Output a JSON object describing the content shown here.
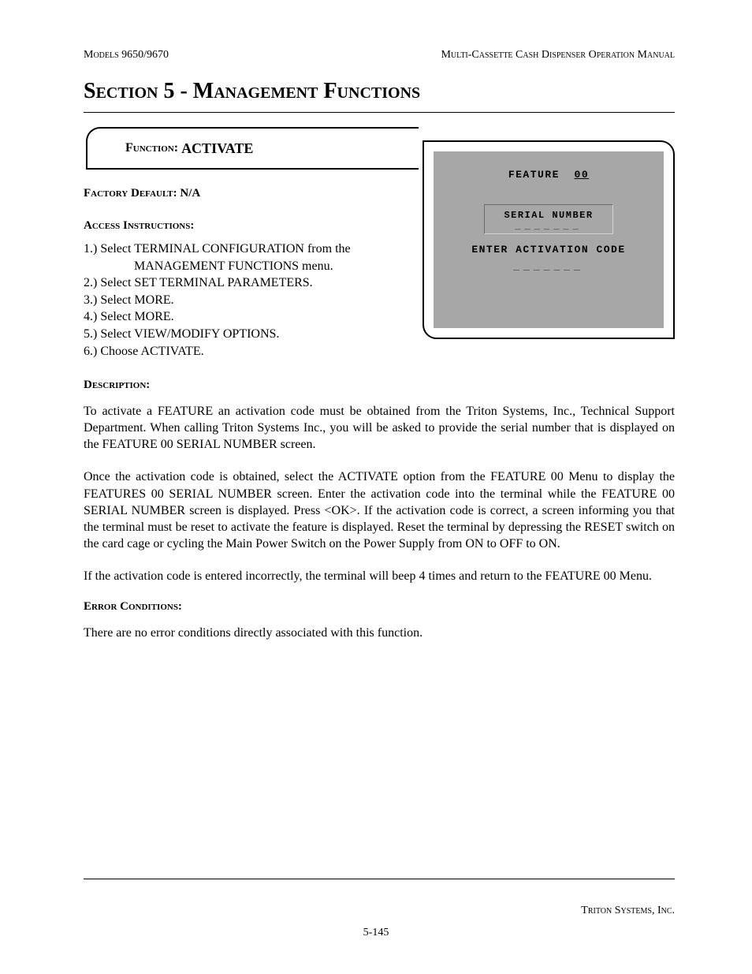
{
  "header": {
    "left": "Models 9650/9670",
    "right": "Multi-Cassette Cash Dispenser Operation Manual"
  },
  "section_title": "Section 5 - Management Functions",
  "tab": {
    "label": "Function:",
    "value": "ACTIVATE"
  },
  "factory_default": {
    "label": "Factory Default:",
    "value": "N/A"
  },
  "access_label": "Access Instructions:",
  "steps": [
    "1.)  Select TERMINAL CONFIGURATION from the",
    "MANAGEMENT FUNCTIONS menu.",
    "2.)  Select SET TERMINAL PARAMETERS.",
    "3.)  Select MORE.",
    "4.)  Select MORE.",
    "5.)  Select VIEW/MODIFY OPTIONS.",
    "6.)  Choose ACTIVATE."
  ],
  "screen": {
    "line1a": "FEATURE",
    "line1b": "00",
    "box_label": "SERIAL NUMBER",
    "box_value": "_______",
    "line2": "ENTER ACTIVATION CODE",
    "line2_value": "_______"
  },
  "description_label": "Description:",
  "paragraphs": [
    "To activate a FEATURE  an activation code must be obtained from the Triton Systems, Inc., Technical Support Department.  When calling Triton Systems Inc., you will be asked to provide the serial number that is displayed on the FEATURE 00 SERIAL NUMBER screen.",
    "Once the activation code is obtained, select the ACTIVATE option from the FEATURE 00 Menu to display the FEATURES 00 SERIAL NUMBER screen.  Enter the activation code into the terminal while the FEATURE 00 SERIAL NUMBER screen is displayed.  Press <OK>.  If the activation code is correct, a screen informing you that the terminal must be reset to activate the feature is displayed.  Reset the terminal by depressing the RESET switch on the card cage or cycling the Main Power Switch on the Power Supply from ON to OFF to ON.",
    "If the activation code is entered incorrectly, the terminal will beep 4 times and return to the FEATURE 00 Menu."
  ],
  "error_label": "Error Conditions:",
  "error_text": "There are no error conditions directly associated with this function.",
  "footer": {
    "company": "Triton Systems, Inc.",
    "page": "5-145"
  }
}
